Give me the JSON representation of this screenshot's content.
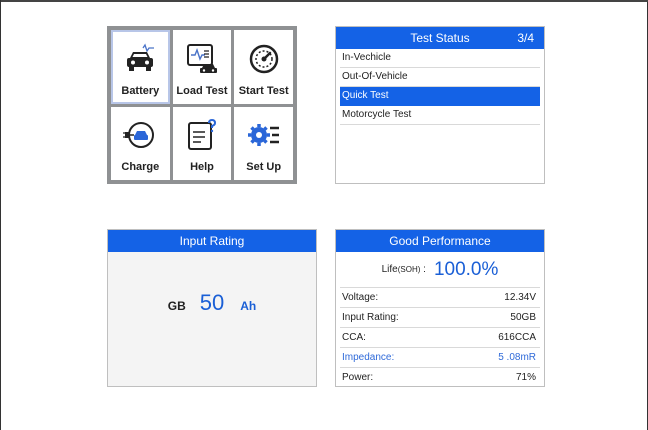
{
  "menu": {
    "tiles": [
      {
        "label": "Battery",
        "icon": "car-battery-icon"
      },
      {
        "label": "Load Test",
        "icon": "load-test-icon"
      },
      {
        "label": "Start Test",
        "icon": "gauge-icon"
      },
      {
        "label": "Charge",
        "icon": "charge-icon"
      },
      {
        "label": "Help",
        "icon": "help-icon"
      },
      {
        "label": "Set Up",
        "icon": "settings-icon"
      }
    ],
    "selected_index": 0
  },
  "test_status": {
    "title": "Test Status",
    "page": "3/4",
    "items": [
      "In-Vechicle",
      "Out-Of-Vehicle",
      "Quick Test",
      "Motorcycle Test"
    ],
    "active_index": 2
  },
  "input_rating": {
    "title": "Input Rating",
    "standard": "GB",
    "value": "50",
    "unit": "Ah"
  },
  "performance": {
    "title": "Good Performance",
    "soh_label": "Life",
    "soh_suffix": "(SOH)",
    "soh_colon": ":",
    "soh_value": "100.0%",
    "rows": [
      {
        "label": "Voltage:",
        "value": "12.34V"
      },
      {
        "label": "Input Rating:",
        "value": "50GB"
      },
      {
        "label": "CCA:",
        "value": "616CCA"
      },
      {
        "label": "Impedance:",
        "value": "5 .08mR"
      },
      {
        "label": "Power:",
        "value": "71%"
      }
    ]
  },
  "colors": {
    "accent": "#1462e6",
    "value_blue": "#1a5fd6"
  }
}
